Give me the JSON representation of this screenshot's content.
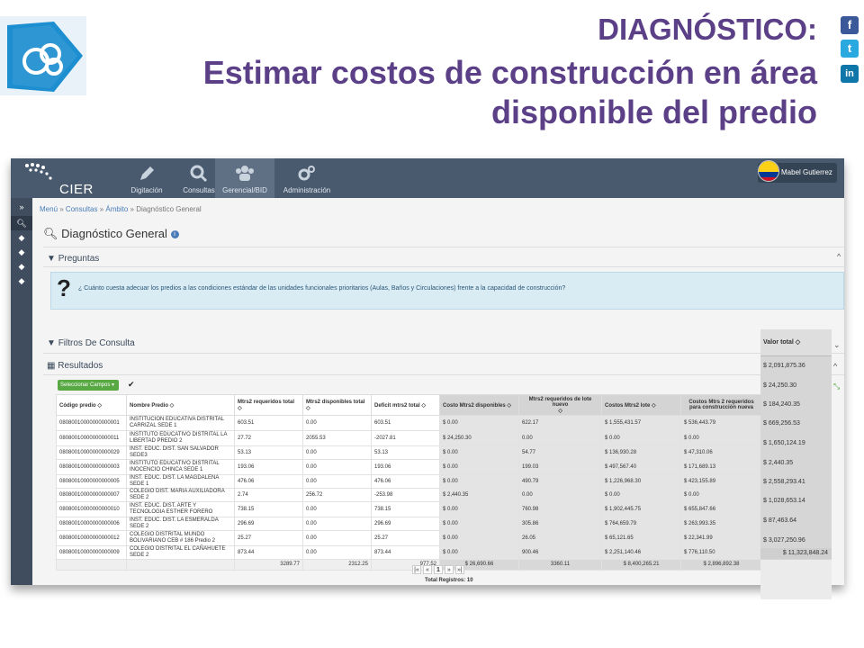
{
  "slide": {
    "title_line1": "DIAGNÓSTICO:",
    "title_line2": "Estimar costos de construcción  en área",
    "title_line3": "disponible del predio",
    "social": [
      "f",
      "t",
      "in"
    ]
  },
  "app": {
    "brand": "CIER",
    "nav_tabs": [
      {
        "label": "Digitación",
        "icon": "pencil-icon"
      },
      {
        "label": "Consultas",
        "icon": "search-icon"
      },
      {
        "label": "Gerencial/BID",
        "icon": "users-icon"
      },
      {
        "label": "Administración",
        "icon": "gears-icon"
      }
    ],
    "user_name": "Mabel Gutierrez",
    "breadcrumb": [
      "Menú",
      "Consultas",
      "Ámbito",
      "Diagnóstico General"
    ],
    "page_title": "Diagnóstico General",
    "preguntas_label": "Preguntas",
    "question_text": "¿ Cuánto cuesta adecuar los predios a las condiciones estándar de las unidades funcionales prioritarios (Aulas, Baños y Circulaciones) frente a la capacidad de construcción?",
    "filtros_label": "Filtros De Consulta",
    "resultados_label": "Resultados",
    "select_fields_label": "Seleccionar Campos",
    "columns": [
      "Código predio",
      "Nombre Predio",
      "Mtrs2 requeridos total",
      "Mtrs2 disponibles total",
      "Deficit mtrs2 total",
      "Costo Mtrs2 disponibles",
      "Mtrs2 requeridos de lote nuevo",
      "Costos Mtrs2 lote",
      "Costos Mtrs 2 requeridos para construcción nueva"
    ],
    "rows": [
      [
        "08080010000000000001",
        "INSTITUCION EDUCATIVA DISTRITAL CARRIZAL SEDE 1",
        "603.51",
        "0.00",
        "603.51",
        "$ 0.00",
        "622.17",
        "$ 1,555,431.57",
        "$ 536,443.79"
      ],
      [
        "08080010000000000011",
        "INSTITUTO EDUCATIVO DISTRITAL LA LIBERTAD PREDIO 2",
        "27.72",
        "2055.53",
        "-2027.81",
        "$ 24,250.30",
        "0.00",
        "$ 0.00",
        "$ 0.00"
      ],
      [
        "08080010000000000029",
        "INST. EDUC. DIST. SAN SALVADOR SEDE3",
        "53.13",
        "0.00",
        "53.13",
        "$ 0.00",
        "54.77",
        "$ 136,930.28",
        "$ 47,310.06"
      ],
      [
        "08080010000000000003",
        "INSTITUTO EDUCATIVO DISTRITAL INOCENCIO CHINCA SEDE 1",
        "193.06",
        "0.00",
        "193.06",
        "$ 0.00",
        "199.03",
        "$ 497,567.40",
        "$ 171,689.13"
      ],
      [
        "08080010000000000005",
        "INST. EDUC. DIST. LA MAGDALENA SEDE 1",
        "476.06",
        "0.00",
        "476.06",
        "$ 0.00",
        "490.79",
        "$ 1,226,968.30",
        "$ 423,155.89"
      ],
      [
        "08080010000000000007",
        "COLEGIO DIST. MARIA AUXILIADORA SEDE 2",
        "2.74",
        "256.72",
        "-253.98",
        "$ 2,440.35",
        "0.00",
        "$ 0.00",
        "$ 0.00"
      ],
      [
        "08080010000000000010",
        "INST. EDUC. DIST. ARTE Y TECNOLOGIA ESTHER FORERO",
        "738.15",
        "0.00",
        "738.15",
        "$ 0.00",
        "760.98",
        "$ 1,902,445.75",
        "$ 655,847.66"
      ],
      [
        "08080010000000000006",
        "INST. EDUC. DIST. LA ESMERALDA SEDE 2",
        "296.69",
        "0.00",
        "296.69",
        "$ 0.00",
        "305.86",
        "$ 764,659.79",
        "$ 263,993.35"
      ],
      [
        "08080010000000000012",
        "COLEGIO DISTRITAL MUNDO BOLIVARIANO CEB # 186 Predio 2",
        "25.27",
        "0.00",
        "25.27",
        "$ 0.00",
        "26.05",
        "$ 65,121.65",
        "$ 22,341.99"
      ],
      [
        "08080010000000000009",
        "COLEGIO DISTRITAL EL CAÑAHUETE SEDE 2",
        "873.44",
        "0.00",
        "873.44",
        "$ 0.00",
        "900.46",
        "$ 2,251,140.46",
        "$ 776,110.50"
      ]
    ],
    "totals": [
      "",
      "",
      "3289.77",
      "2312.25",
      "977.52",
      "$ 26,690.66",
      "3360.11",
      "$ 8,400,265.21",
      "$ 2,896,892.38"
    ],
    "pager": {
      "first": "|«",
      "prev": "«",
      "current": "1",
      "next": "»",
      "last": "»|"
    },
    "total_registros": "Total Registros: 10",
    "valor_total": {
      "header": "Valor total",
      "values": [
        "$ 2,091,875.36",
        "$ 24,250.30",
        "$ 184,240.35",
        "$ 669,256.53",
        "$ 1,650,124.19",
        "$ 2,440.35",
        "$ 2,558,293.41",
        "$ 1,028,653.14",
        "$ 87,463.64",
        "$ 3,027,250.96"
      ],
      "total": "$ 11,323,848.24"
    }
  },
  "colors": {
    "title": "#5b3f87",
    "navbar": "#4a5a6e",
    "sidebar": "#3f4d5e",
    "question_bg": "#d9ebf3",
    "select_button": "#58a843"
  }
}
